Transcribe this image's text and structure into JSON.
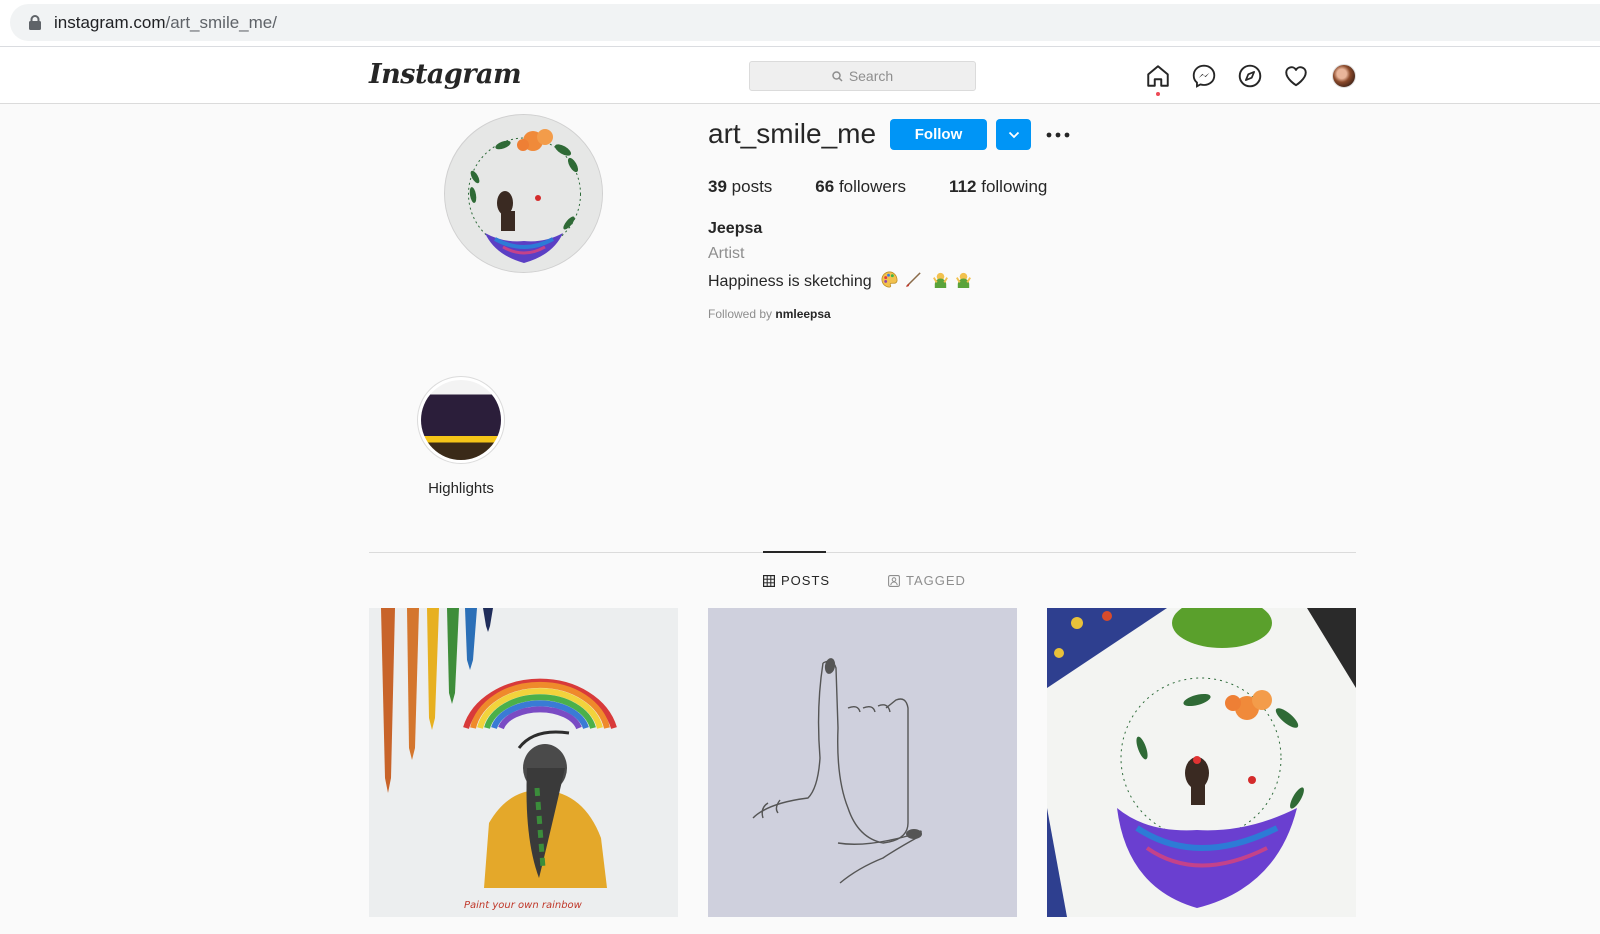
{
  "browser": {
    "url_domain": "instagram.com",
    "url_path": "/art_smile_me/"
  },
  "header": {
    "logo": "Instagram",
    "search_placeholder": "Search"
  },
  "profile": {
    "username": "art_smile_me",
    "follow_label": "Follow",
    "posts_count": "39",
    "posts_label": "posts",
    "followers_count": "66",
    "followers_label": "followers",
    "following_count": "112",
    "following_label": "following",
    "full_name": "Jeepsa",
    "category": "Artist",
    "bio": "Happiness is sketching",
    "followed_by_prefix": "Followed by",
    "followed_by_name": "nmleepsa"
  },
  "highlights": [
    {
      "label": "Highlights"
    }
  ],
  "tabs": [
    {
      "label": "POSTS",
      "active": true
    },
    {
      "label": "TAGGED",
      "active": false
    }
  ],
  "posts": [
    {
      "caption": "Paint your own rainbow"
    },
    {
      "caption": ""
    },
    {
      "caption": ""
    }
  ],
  "colors": {
    "accent": "#0095f6",
    "notification": "#ed4956"
  }
}
